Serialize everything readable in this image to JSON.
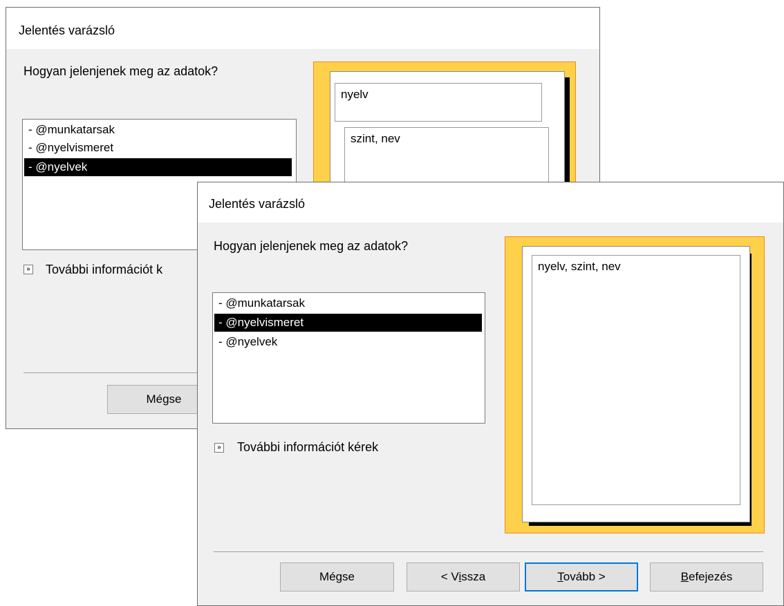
{
  "back_dialog": {
    "title": "Jelentés varázsló",
    "question": "Hogyan jelenjenek meg az adatok?",
    "list_items": [
      "- @munkatarsak",
      "- @nyelvismeret",
      "- @nyelvek"
    ],
    "selected_index": 2,
    "more_info": "További információt k",
    "preview": {
      "group_header": "nyelv",
      "detail": "szint, nev"
    },
    "buttons": {
      "cancel": "Mégse"
    }
  },
  "front_dialog": {
    "title": "Jelentés varázsló",
    "question": "Hogyan jelenjenek meg az adatok?",
    "list_items": [
      "- @munkatarsak",
      "- @nyelvismeret",
      "- @nyelvek"
    ],
    "selected_index": 1,
    "more_info": "További információt kérek",
    "preview": {
      "detail": "nyelv, szint, nev"
    },
    "buttons": {
      "cancel": "Mégse",
      "back_prefix": "< V",
      "back_accel": "i",
      "back_suffix": "ssza",
      "next_accel": "T",
      "next_suffix": "ovább >",
      "finish_accel": "B",
      "finish_suffix": "efejezés"
    }
  },
  "colors": {
    "dialog_bg": "#f0f0f0",
    "selection": "#000000",
    "preview_yellow": "#ffd04a",
    "preview_border": "#f08a1e",
    "default_button_border": "#0078d7"
  }
}
